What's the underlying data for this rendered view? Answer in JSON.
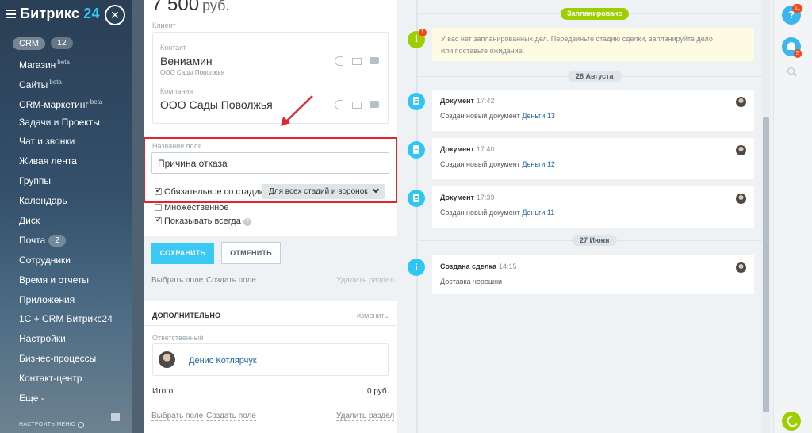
{
  "sidebar": {
    "logo_name": "Битрикс",
    "logo_num": "24",
    "close_glyph": "×",
    "crm": {
      "label": "CRM",
      "count": "12"
    },
    "items": [
      {
        "label": "Магазин",
        "sup": "beta"
      },
      {
        "label": "Сайты",
        "sup": "beta"
      },
      {
        "label": "CRM-маркетинг",
        "sup": "beta"
      },
      {
        "label": "Задачи и Проекты"
      },
      {
        "label": "Чат и звонки"
      },
      {
        "label": "Живая лента"
      },
      {
        "label": "Группы"
      },
      {
        "label": "Календарь"
      },
      {
        "label": "Диск"
      },
      {
        "label": "Почта",
        "count": "2"
      },
      {
        "label": "Сотрудники"
      },
      {
        "label": "Время и отчеты"
      },
      {
        "label": "Приложения"
      },
      {
        "label": "1С + CRM Битрикс24"
      },
      {
        "label": "Настройки"
      },
      {
        "label": "Бизнес-процессы"
      },
      {
        "label": "Контакт-центр"
      },
      {
        "label": "Еще -"
      }
    ],
    "configure_label": "НАСТРОИТЬ МЕНЮ"
  },
  "deal": {
    "price": "7 500",
    "currency": "руб.",
    "client_label": "Клиент",
    "contact_label": "Контакт",
    "contact_name": "Вениамин",
    "contact_company": "ООО Сады Поволжья",
    "company_label": "Компания",
    "company_name": "ООО Сады Поволжья"
  },
  "field_editor": {
    "name_label": "Название поля",
    "name_value": "Причина отказа",
    "required_label": "Обязательное со стадии:",
    "required_checked": true,
    "stage_select": "Для всех стадий и воронок",
    "multiple_label": "Множественное",
    "multiple_checked": false,
    "show_always_label": "Показывать всегда",
    "show_always_checked": true,
    "help_glyph": "?",
    "save_label": "СОХРАНИТЬ",
    "cancel_label": "ОТМЕНИТЬ"
  },
  "section_links": {
    "select_field": "Выбрать поле",
    "create_field": "Создать поле",
    "delete_section": "Удалить раздел"
  },
  "extra": {
    "title": "ДОПОЛНИТЕЛЬНО",
    "change": "изменить",
    "responsible_label": "Ответственный",
    "responsible_name": "Денис Котлярчук",
    "total_label": "Итого",
    "total_value": "0 руб."
  },
  "timeline": {
    "planned_label": "Запланировано",
    "info_glyph": "i",
    "info_badge": "1",
    "planned_text": "У вас нет запланированных дел. Передвиньте стадию сделки, запланируйте дело или поставьте ожидание.",
    "date1": "28 Августа",
    "date2": "27 Июня",
    "events": [
      {
        "title": "Документ",
        "time": "17:42",
        "desc": "Создан новый документ",
        "link": "Деньги 13"
      },
      {
        "title": "Документ",
        "time": "17:40",
        "desc": "Создан новый документ",
        "link": "Деньги 12"
      },
      {
        "title": "Документ",
        "time": "17:39",
        "desc": "Создан новый документ",
        "link": "Деньги 11"
      }
    ],
    "deal_created": {
      "title": "Создана сделка",
      "time": "14:15",
      "desc": "Доставка черешни"
    }
  },
  "right_panel": {
    "help_glyph": "?",
    "help_badge": "11",
    "notif_badge": "5"
  },
  "colors": {
    "accent_blue": "#2fc6f6",
    "accent_green": "#9dcf00",
    "highlight_red": "#e3262b",
    "link_blue": "#2067b0"
  },
  "icons": [
    "burger-icon",
    "close-icon",
    "phone-icon",
    "mail-icon",
    "chat-icon",
    "chevron-down-icon",
    "help-icon",
    "info-icon",
    "document-icon",
    "bell-icon",
    "search-icon",
    "phone-call-icon"
  ]
}
